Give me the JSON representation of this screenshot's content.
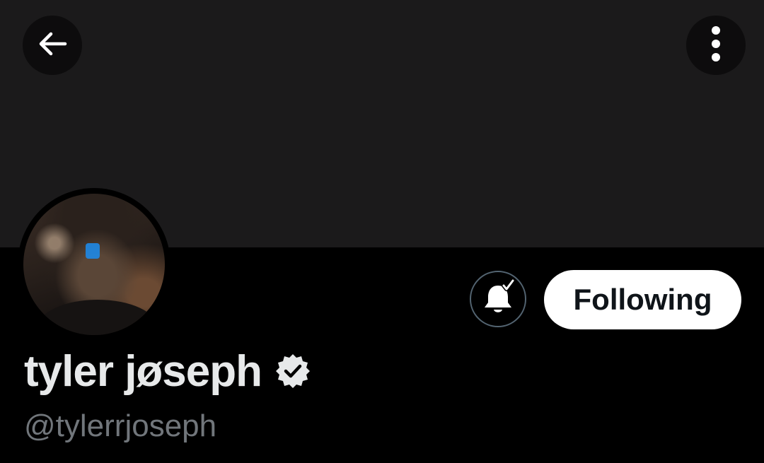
{
  "header": {
    "back_icon": "arrow-left-icon",
    "more_icon": "vertical-dots-icon"
  },
  "profile": {
    "display_name": "tyler jøseph",
    "handle": "@tylerrjoseph",
    "verified_icon": "verified-badge-icon",
    "avatar": "profile-photo"
  },
  "actions": {
    "notifications_icon": "bell-check-icon",
    "follow_label": "Following"
  },
  "colors": {
    "background": "#000000",
    "banner": "#1b1a1b",
    "name": "#e7e9ea",
    "handle": "#71767b",
    "button_bg": "#ffffff",
    "button_text": "#0f1419",
    "outline": "#536471"
  }
}
